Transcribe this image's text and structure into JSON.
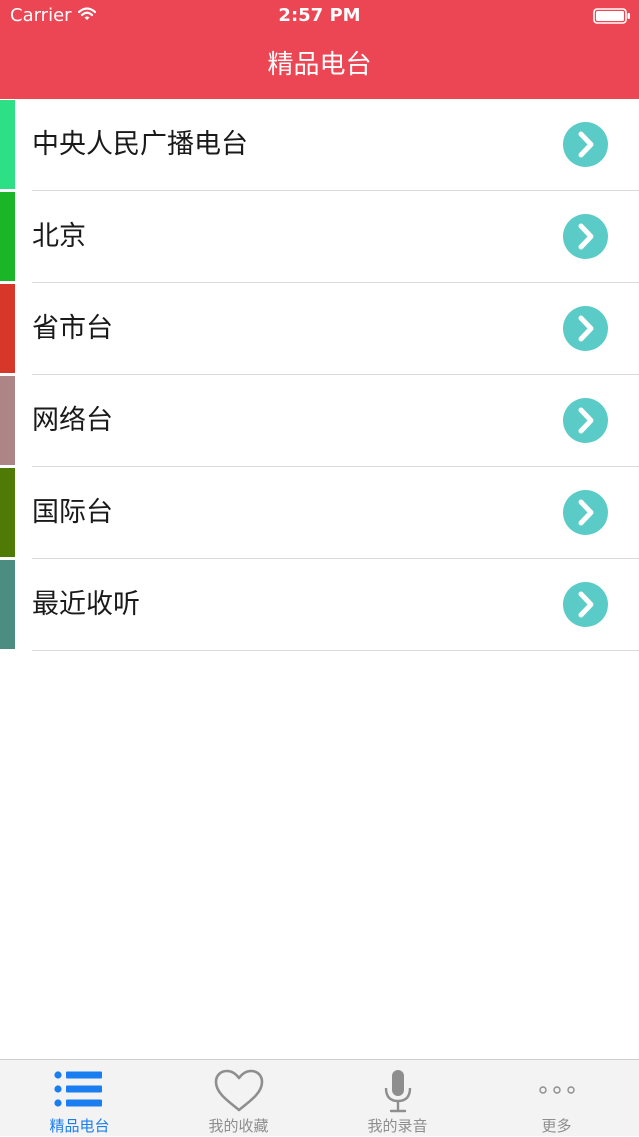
{
  "status_bar": {
    "carrier": "Carrier",
    "time": "2:57 PM"
  },
  "nav": {
    "title": "精品电台",
    "background_color": "#ec4553"
  },
  "list": {
    "items": [
      {
        "label": "中央人民广播电台",
        "accent_color": "#2ee085"
      },
      {
        "label": "北京",
        "accent_color": "#1ab627"
      },
      {
        "label": "省市台",
        "accent_color": "#d73728"
      },
      {
        "label": "网络台",
        "accent_color": "#ad8586"
      },
      {
        "label": "国际台",
        "accent_color": "#4e7a05"
      },
      {
        "label": "最近收听",
        "accent_color": "#4b8d80"
      }
    ],
    "chevron_icon": "chevron-right-circle-icon",
    "chevron_color": "#5acbc6"
  },
  "tab_bar": {
    "active_color": "#1b7ef0",
    "inactive_color": "#8e8e8e",
    "tabs": [
      {
        "label": "精品电台",
        "icon": "list-icon",
        "active": true
      },
      {
        "label": "我的收藏",
        "icon": "heart-icon",
        "active": false
      },
      {
        "label": "我的录音",
        "icon": "microphone-icon",
        "active": false
      },
      {
        "label": "更多",
        "icon": "more-dots-icon",
        "active": false
      }
    ]
  }
}
